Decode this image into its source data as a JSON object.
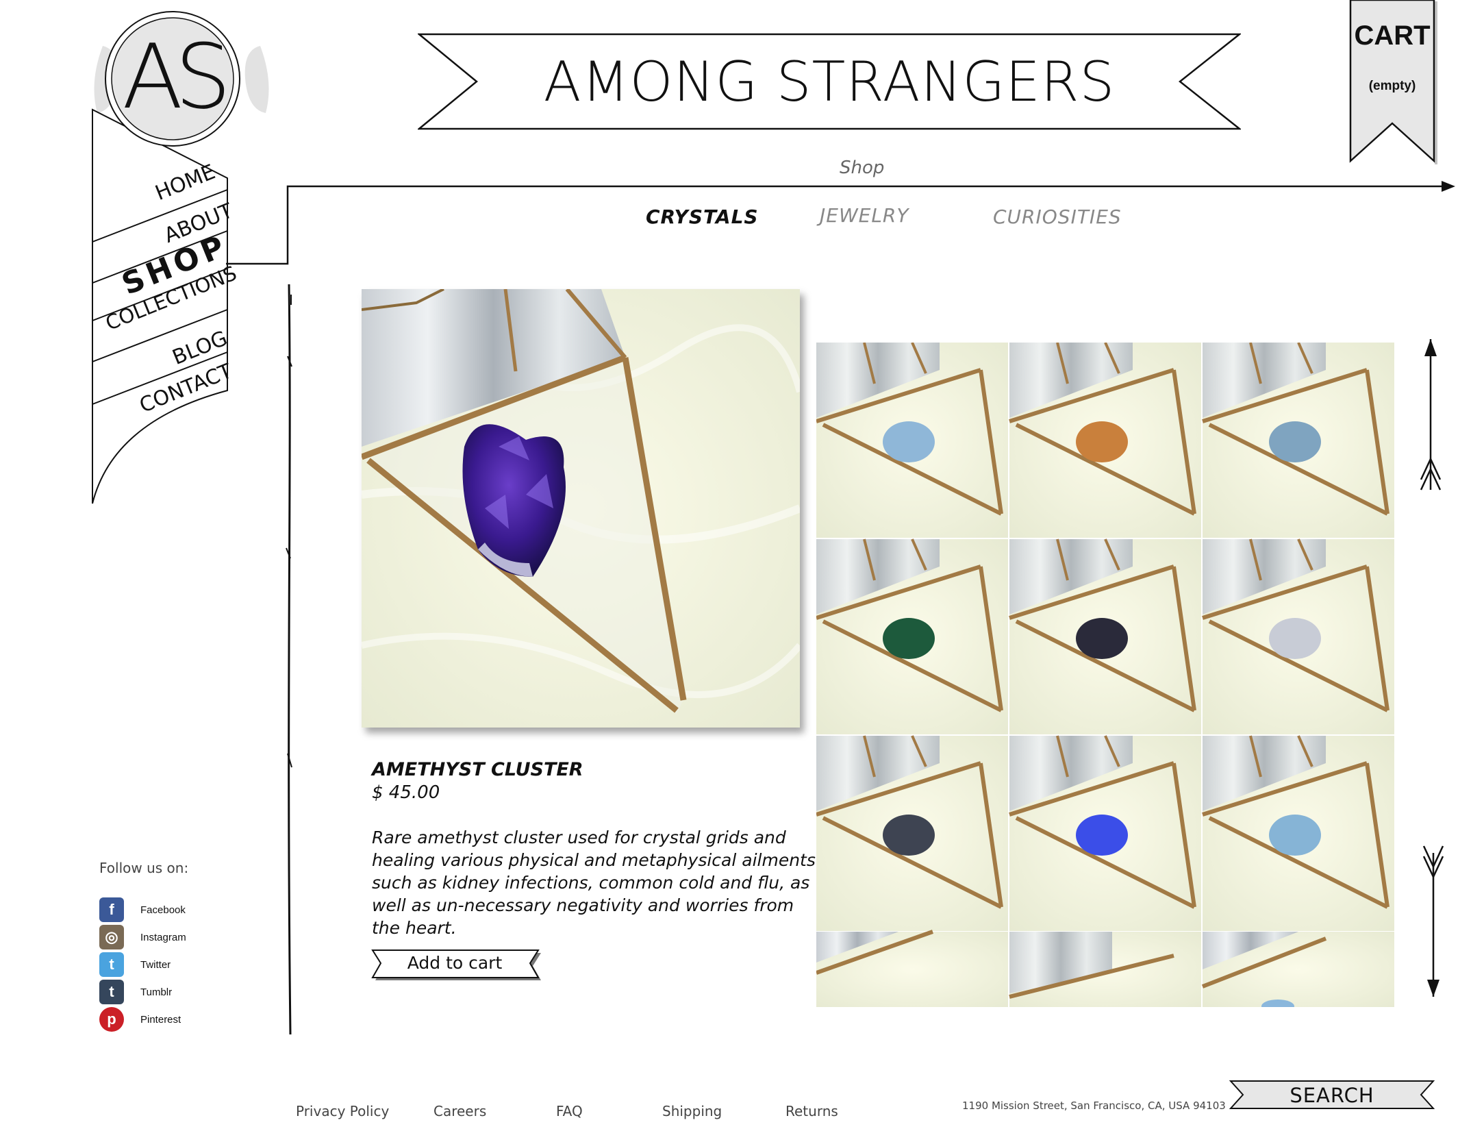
{
  "logo": {
    "monogram": "AS"
  },
  "nav": {
    "items": [
      "HOME",
      "ABOUT",
      "SHOP",
      "COLLECTIONS",
      "BLOG",
      "CONTACT"
    ],
    "active": "SHOP"
  },
  "header": {
    "title": "AMONG STRANGERS"
  },
  "cart": {
    "label": "CART",
    "status": "(empty)"
  },
  "breadcrumb": {
    "label": "Shop"
  },
  "categories": [
    "CRYSTALS",
    "JEWELRY",
    "CURIOSITIES"
  ],
  "active_category": "CRYSTALS",
  "product": {
    "name": "AMETHYST CLUSTER",
    "price": "$ 45.00",
    "description": "Rare amethyst cluster used for crystal grids and healing various physical and metaphysical ailments such as kidney infections, common cold and flu, as well as un-necessary negativity and worries from the heart.",
    "add_to_cart": "Add to cart"
  },
  "thumbnails": [
    {
      "stone_color": "#8fb7d8"
    },
    {
      "stone_color": "#c9803c"
    },
    {
      "stone_color": "#7fa4c0"
    },
    {
      "stone_color": "#1d5a3c"
    },
    {
      "stone_color": "#2a2a3a"
    },
    {
      "stone_color": "#c8ccd6"
    },
    {
      "stone_color": "#3e4452"
    },
    {
      "stone_color": "#3b4ee8"
    },
    {
      "stone_color": "#86b4d6"
    },
    {
      "stone_color": "#cfd8e2"
    },
    {
      "stone_color": "#cfd8e2"
    },
    {
      "stone_color": "#8ab7dc"
    }
  ],
  "social": {
    "heading": "Follow us on:",
    "links": [
      {
        "label": "Facebook",
        "icon": "facebook-icon",
        "glyph": "f",
        "color": "#3b5998"
      },
      {
        "label": "Instagram",
        "icon": "instagram-icon",
        "glyph": "◎",
        "color": "#7a6a55"
      },
      {
        "label": "Twitter",
        "icon": "twitter-icon",
        "glyph": "t",
        "color": "#4aa3df"
      },
      {
        "label": "Tumblr",
        "icon": "tumblr-icon",
        "glyph": "t",
        "color": "#35465c"
      },
      {
        "label": "Pinterest",
        "icon": "pinterest-icon",
        "glyph": "p",
        "color": "#cb2027"
      }
    ]
  },
  "footer": {
    "links": [
      "Privacy Policy",
      "Careers",
      "FAQ",
      "Shipping",
      "Returns"
    ],
    "address": "1190 Mission Street, San Francisco, CA, USA 94103",
    "search_label": "SEARCH"
  }
}
